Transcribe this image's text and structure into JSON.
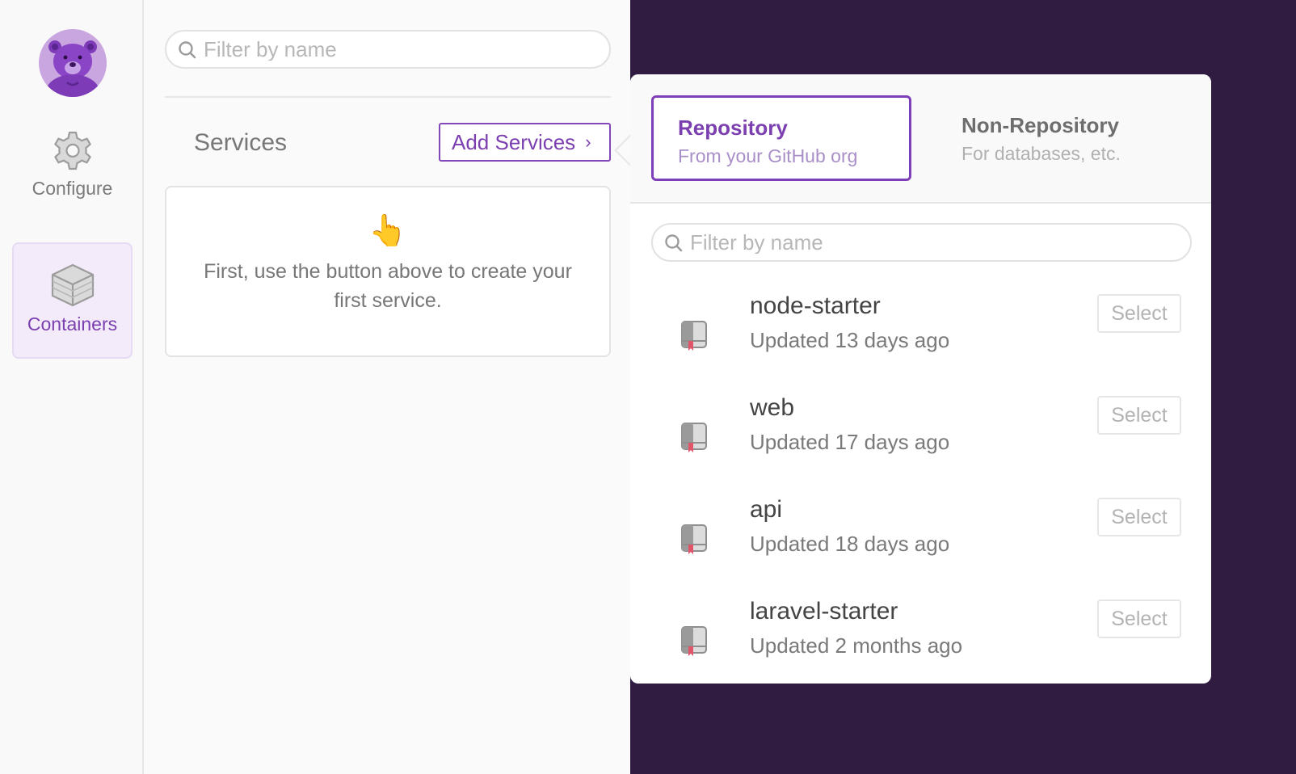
{
  "sidebar": {
    "avatar_icon": "bear-avatar",
    "items": [
      {
        "label": "Configure",
        "icon": "gear-icon"
      },
      {
        "label": "Containers",
        "icon": "box-icon",
        "active": true
      }
    ]
  },
  "main": {
    "search": {
      "placeholder": "Filter by name",
      "value": ""
    },
    "services_label": "Services",
    "add_services_label": "Add Services",
    "empty_state": {
      "emoji": "👆",
      "text": "First, use the button above to create your first service."
    }
  },
  "popover": {
    "tabs": [
      {
        "title": "Repository",
        "subtitle": "From your GitHub org",
        "active": true
      },
      {
        "title": "Non-Repository",
        "subtitle": "For databases, etc.",
        "active": false
      }
    ],
    "search": {
      "placeholder": "Filter by name",
      "value": ""
    },
    "repos": [
      {
        "name": "node-starter",
        "updated": "Updated 13 days ago",
        "select_label": "Select"
      },
      {
        "name": "web",
        "updated": "Updated 17 days ago",
        "select_label": "Select"
      },
      {
        "name": "api",
        "updated": "Updated 18 days ago",
        "select_label": "Select"
      },
      {
        "name": "laravel-starter",
        "updated": "Updated 2 months ago",
        "select_label": "Select"
      }
    ]
  },
  "colors": {
    "accent": "#7b3fb0",
    "background_dark": "#301c40",
    "sidebar_active_bg": "#f3ebfa"
  }
}
